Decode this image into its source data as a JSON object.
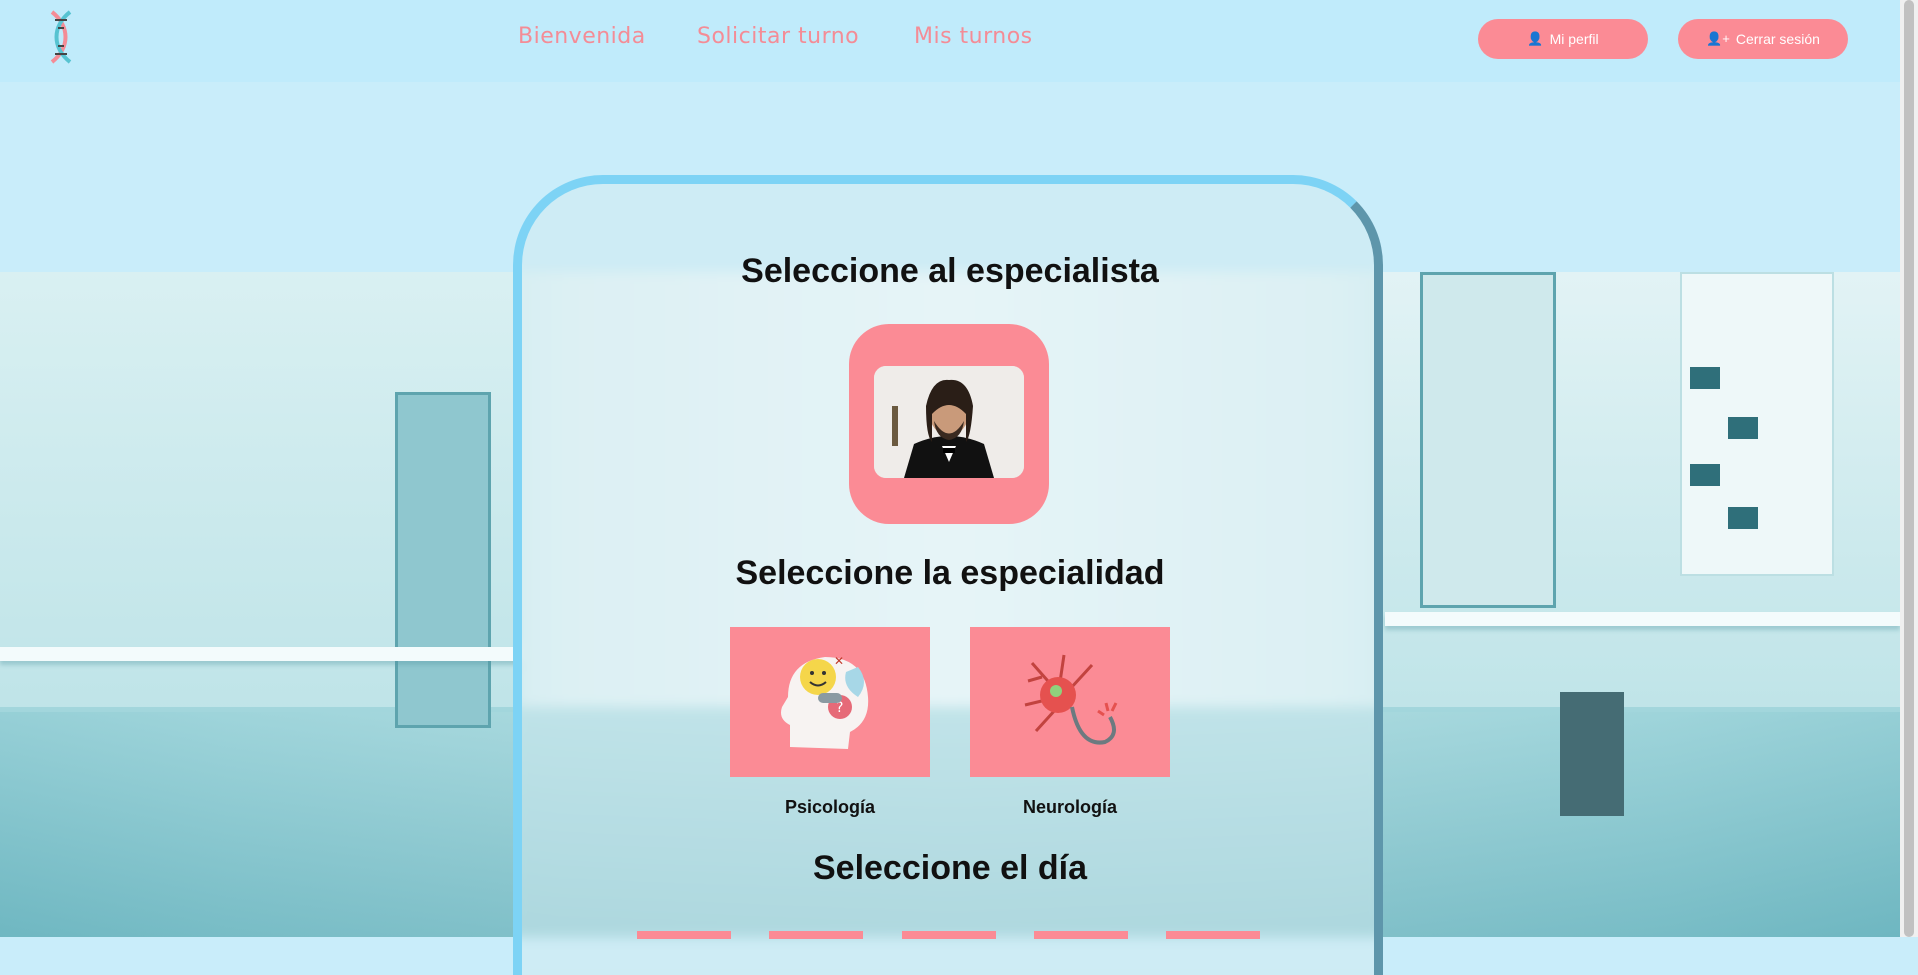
{
  "nav": {
    "links": [
      "Bienvenida",
      "Solicitar turno",
      "Mis turnos"
    ],
    "profile_button": "Mi perfil",
    "logout_button": "Cerrar sesión"
  },
  "main": {
    "specialist_title": "Seleccione al especialista",
    "specialty_title": "Seleccione la especialidad",
    "day_title": "Seleccione el día",
    "specialties": [
      {
        "label": "Psicología",
        "icon": "psychology-head-icon"
      },
      {
        "label": "Neurología",
        "icon": "neuron-icon"
      }
    ],
    "day_chip_count": 5
  },
  "colors": {
    "accent": "#fb8b95",
    "nav_bg": "#c0ebfb",
    "card_border": "#7dd3f5"
  }
}
